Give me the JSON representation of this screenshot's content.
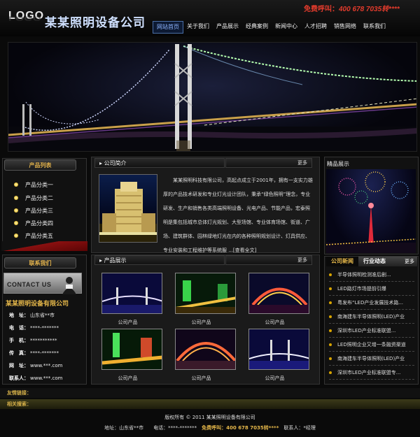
{
  "header": {
    "logo": "LOGO",
    "company": "某某照明设备公司",
    "hotline_label": "免费呼叫：",
    "hotline_number": "400 678 7035转****",
    "nav": [
      "网站首页",
      "关于我们",
      "产品展示",
      "经典案例",
      "新闻中心",
      "人才招聘",
      "销售网络",
      "联系我们"
    ],
    "nav_active": 0
  },
  "categories": {
    "title": "产品列表",
    "items": [
      "产品分类一",
      "产品分类二",
      "产品分类三",
      "产品分类四",
      "产品分类五"
    ]
  },
  "contact": {
    "title": "联系我们",
    "banner_text": "CONTACT US",
    "company": "某某照明设备有限公司",
    "rows": [
      {
        "label": "地　址：",
        "value": "山东省**市"
      },
      {
        "label": "电　话：",
        "value": "****-*******"
      },
      {
        "label": "手　机：",
        "value": "***********"
      },
      {
        "label": "传　真：",
        "value": "****-*******"
      },
      {
        "label": "网　址：",
        "value": "www.***.com"
      },
      {
        "label": "联系人：",
        "value": "www.***.com"
      }
    ]
  },
  "about": {
    "title": "公司简介",
    "more": "更多",
    "text": "某某照明科技有限公司，高起点成立于2001年，拥有一支实力雄厚的产品技术研发和专业灯光设计团队，秉承“绿色照明”理念，专业研发、生产和销售各类高端照明设备、光电产品、节能产品，宏泰照明是集包括城市总体灯光规划、大型场馆、专业体育场馆、街道、广场、建筑群体、园林绿地灯光在内的各种照明规划设计、灯具供应、专业安装和工程维护等系统服 ...[查看全文]"
  },
  "products": {
    "title": "产品展示",
    "more": "更多",
    "items": [
      "公司产品",
      "公司产品",
      "公司产品",
      "公司产品",
      "公司产品",
      "公司产品"
    ]
  },
  "featured": {
    "title": "精品展示"
  },
  "news": {
    "tabs": [
      "公司新闻",
      "行业动态"
    ],
    "more": "更多",
    "items": [
      "半导体照明检测准后剧...",
      "LED路灯市场提前引爆",
      "粤发布“LED产业发展技术路...",
      "南海建车半导体照明(LED)产业",
      "深圳市LED产业标准联盟...",
      "LED照明企业又增一条融资渠道",
      "南海建车半导体照明(LED)产业",
      "深圳市LED产业标准联盟专..."
    ]
  },
  "footer": {
    "links_label": "友情链接：",
    "search_label": "相关搜索：",
    "copyright": "版权所有 © 2011  某某照明设备有限公司",
    "address": "地址：山东省**市　　电话：****-*******　",
    "hotline_label": "免费呼叫：",
    "hotline_number": "400 678 7035转****",
    "contact_person": "　联系人：*经理"
  },
  "colors": {
    "accent_gold": "#e6b84a",
    "hotline_red": "#e23b2c",
    "nav_active": "#4a6fa8"
  }
}
